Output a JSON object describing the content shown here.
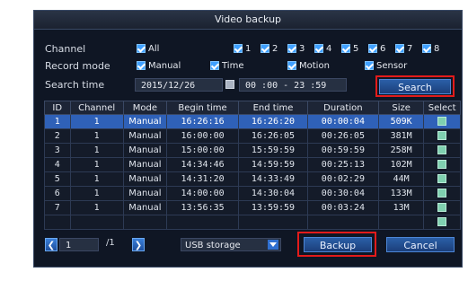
{
  "window": {
    "title": "Video backup"
  },
  "filters": {
    "channel_label": "Channel",
    "channel_all": "All",
    "channels": [
      "1",
      "2",
      "3",
      "4",
      "5",
      "6",
      "7",
      "8"
    ],
    "record_mode_label": "Record mode",
    "record_modes": [
      "Manual",
      "Time",
      "Motion",
      "Sensor"
    ],
    "search_time_label": "Search time",
    "date": "2015/12/26",
    "time_range": "00 :00 - 23 :59",
    "search_button": "Search"
  },
  "table": {
    "headers": [
      "ID",
      "Channel",
      "Mode",
      "Begin time",
      "End time",
      "Duration",
      "Size",
      "Select"
    ],
    "rows": [
      {
        "id": "1",
        "channel": "1",
        "mode": "Manual",
        "begin": "16:26:16",
        "end": "16:26:20",
        "duration": "00:00:04",
        "size": "509K"
      },
      {
        "id": "2",
        "channel": "1",
        "mode": "Manual",
        "begin": "16:00:00",
        "end": "16:26:05",
        "duration": "00:26:05",
        "size": "381M"
      },
      {
        "id": "3",
        "channel": "1",
        "mode": "Manual",
        "begin": "15:00:00",
        "end": "15:59:59",
        "duration": "00:59:59",
        "size": "258M"
      },
      {
        "id": "4",
        "channel": "1",
        "mode": "Manual",
        "begin": "14:34:46",
        "end": "14:59:59",
        "duration": "00:25:13",
        "size": "102M"
      },
      {
        "id": "5",
        "channel": "1",
        "mode": "Manual",
        "begin": "14:31:20",
        "end": "14:33:49",
        "duration": "00:02:29",
        "size": "44M"
      },
      {
        "id": "6",
        "channel": "1",
        "mode": "Manual",
        "begin": "14:00:00",
        "end": "14:30:04",
        "duration": "00:30:04",
        "size": "133M"
      },
      {
        "id": "7",
        "channel": "1",
        "mode": "Manual",
        "begin": "13:56:35",
        "end": "13:59:59",
        "duration": "00:03:24",
        "size": "13M"
      }
    ]
  },
  "footer": {
    "page_current": "1",
    "page_total": "/1",
    "storage": "USB storage",
    "backup_button": "Backup",
    "cancel_button": "Cancel"
  },
  "colors": {
    "highlight": "#e31b1b",
    "selected_row": "#2f61b8",
    "accent": "#3fa0ff"
  }
}
